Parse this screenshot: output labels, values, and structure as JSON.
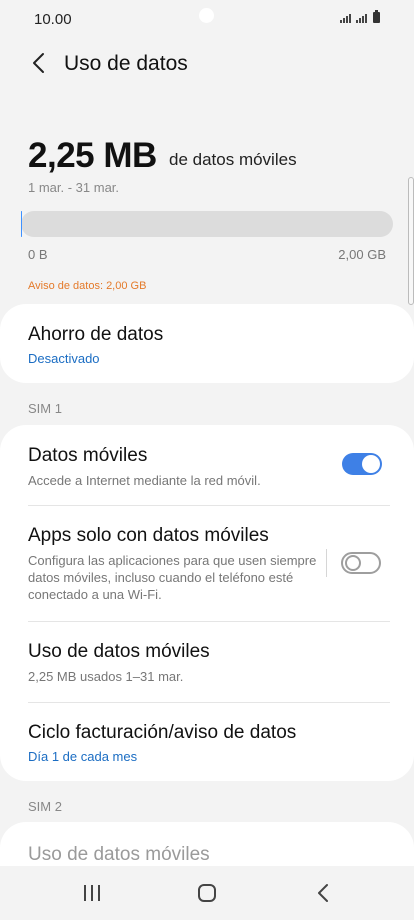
{
  "status": {
    "time": "10.00"
  },
  "header": {
    "title": "Uso de datos",
    "back_icon": "back-arrow-icon"
  },
  "usage": {
    "amount": "2,25 MB",
    "unit_label": "de datos móviles",
    "period": "1 mar. - 31 mar.",
    "bar_fraction": 0.001,
    "bar_min": "0 B",
    "bar_max": "2,00 GB",
    "warning": "Aviso de datos: 2,00 GB"
  },
  "data_saver": {
    "title": "Ahorro de datos",
    "status": "Desactivado"
  },
  "sim1": {
    "label": "SIM 1",
    "items": [
      {
        "title": "Datos móviles",
        "subtitle": "Accede a Internet mediante la red móvil.",
        "toggle": true
      },
      {
        "title": "Apps solo con datos móviles",
        "subtitle": "Configura las aplicaciones para que usen siempre datos móviles, incluso cuando el teléfono esté conectado a una Wi-Fi.",
        "toggle": false
      },
      {
        "title": "Uso de datos móviles",
        "subtitle": "2,25 MB usados 1–31 mar."
      },
      {
        "title": "Ciclo facturación/aviso de datos",
        "subtitle": "Día 1 de cada mes"
      }
    ]
  },
  "sim2": {
    "label": "SIM 2",
    "items": [
      {
        "title": "Uso de datos móviles"
      }
    ]
  },
  "colors": {
    "accent": "#3e80e6",
    "link": "#1b6dc3",
    "warning": "#e47a2a"
  },
  "nav": {
    "recent_icon": "recent-apps-icon",
    "home_icon": "home-icon",
    "back_icon": "back-icon"
  }
}
